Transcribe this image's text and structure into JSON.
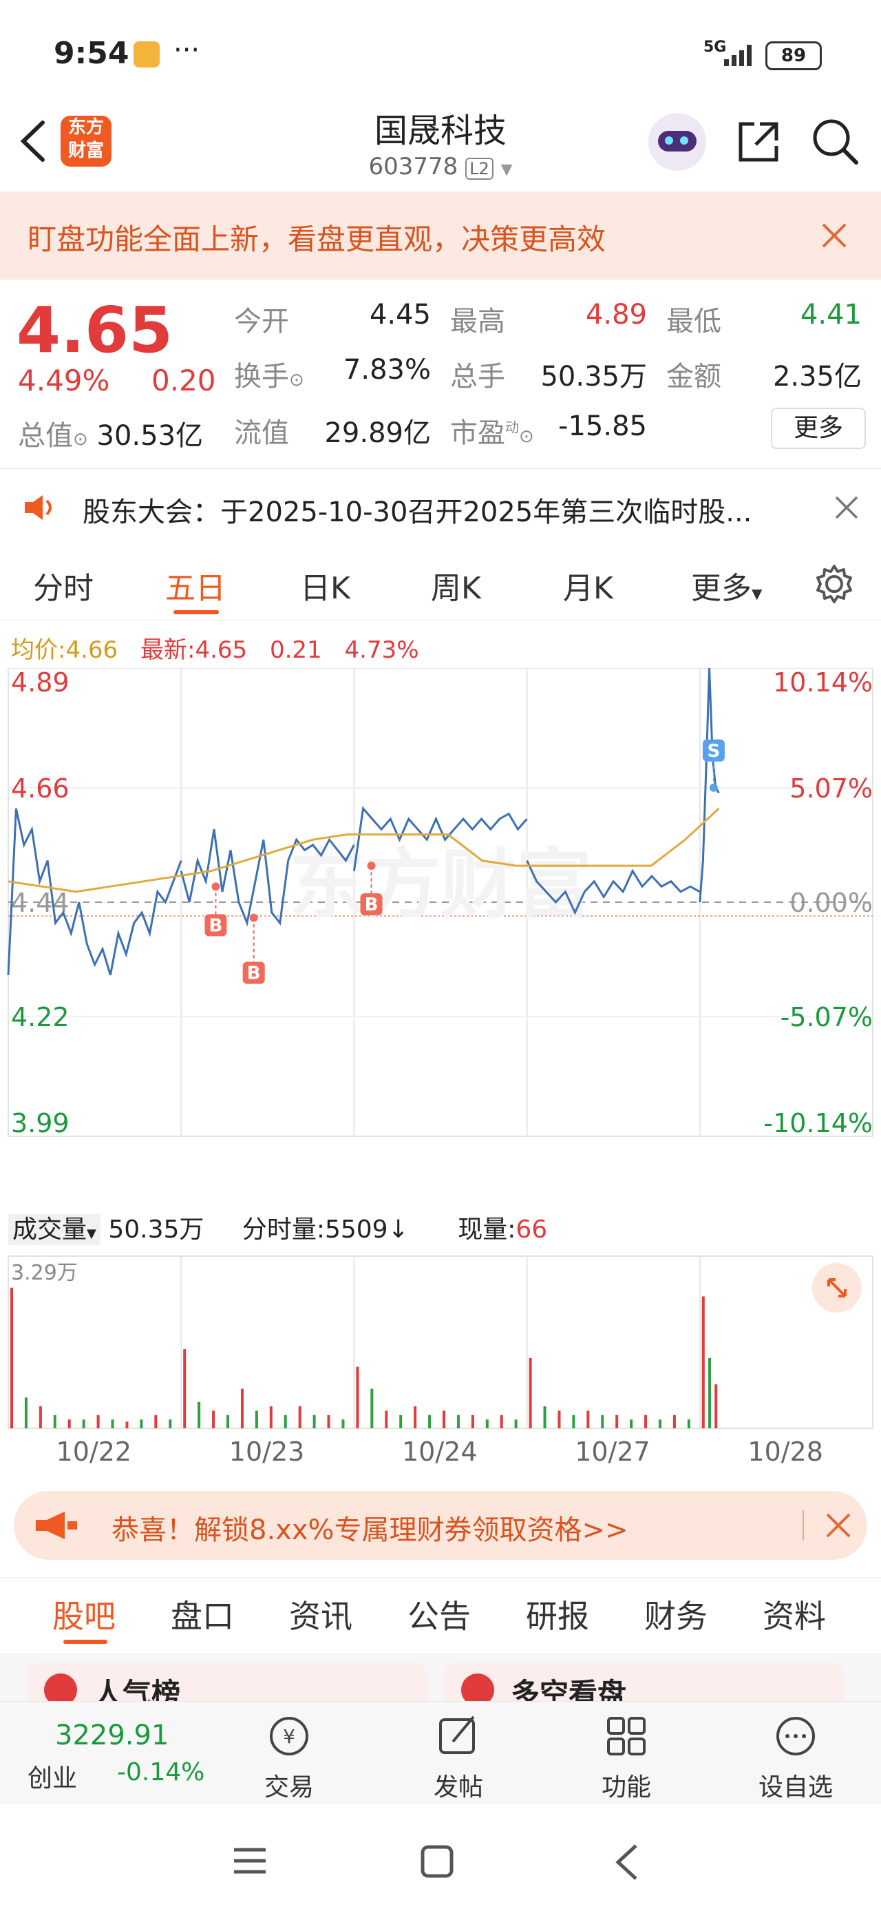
{
  "status_bar": {
    "time": "9:54",
    "more": "···",
    "network": "5G",
    "battery": "89"
  },
  "header": {
    "title": "国晟科技",
    "code": "603778",
    "level": "L2",
    "logo_line1": "东方",
    "logo_line2": "财富"
  },
  "banner": {
    "text": "盯盘功能全面上新，看盘更直观，决策更高效"
  },
  "quote": {
    "price": "4.65",
    "change_pct": "4.49%",
    "change": "0.20",
    "market_cap_label": "总值",
    "market_cap": "30.53亿",
    "fields": [
      {
        "label": "今开",
        "value": "4.45"
      },
      {
        "label": "最高",
        "value": "4.89"
      },
      {
        "label": "最低",
        "value": "4.41"
      },
      {
        "label": "换手",
        "value": "7.83%"
      },
      {
        "label": "总手",
        "value": "50.35万"
      },
      {
        "label": "金额",
        "value": "2.35亿"
      },
      {
        "label": "流值",
        "value": "29.89亿"
      },
      {
        "label": "市盈",
        "value": "-15.85"
      }
    ],
    "pe_tag": "动",
    "more_button": "更多"
  },
  "notice": {
    "text": "股东大会：于2025-10-30召开2025年第三次临时股..."
  },
  "tabs": [
    "分时",
    "五日",
    "日K",
    "周K",
    "月K",
    "更多"
  ],
  "chart_info": {
    "avg_label": "均价:",
    "avg_value": "4.66",
    "latest_label": "最新:",
    "latest_value": "4.65",
    "latest_change": "0.21",
    "latest_pct": "4.73%"
  },
  "chart_data": {
    "type": "line",
    "y_left_ticks": [
      "4.89",
      "4.66",
      "4.44",
      "4.22",
      "3.99"
    ],
    "y_right_ticks": [
      "10.14%",
      "5.07%",
      "0.00%",
      "-5.07%",
      "-10.14%"
    ],
    "ylim": [
      3.99,
      4.89
    ],
    "prev_close": 4.44,
    "x_labels": [
      "10/22",
      "10/23",
      "10/24",
      "10/27",
      "10/28"
    ],
    "days": [
      {
        "day": "10/22",
        "open": 4.3,
        "points": [
          4.3,
          4.62,
          4.55,
          4.58,
          4.48,
          4.52,
          4.4,
          4.42,
          4.38,
          4.44,
          4.36,
          4.32,
          4.35,
          4.3,
          4.38,
          4.34,
          4.4,
          4.42,
          4.38,
          4.46,
          4.44,
          4.48,
          4.52
        ]
      },
      {
        "day": "10/23",
        "open": 4.5,
        "points": [
          4.5,
          4.44,
          4.52,
          4.48,
          4.58,
          4.46,
          4.54,
          4.44,
          4.4,
          4.48,
          4.56,
          4.42,
          4.4,
          4.52,
          4.56,
          4.54,
          4.55,
          4.53,
          4.56,
          4.54,
          4.52,
          4.55
        ]
      },
      {
        "day": "10/24",
        "open": 4.5,
        "points": [
          4.5,
          4.62,
          4.6,
          4.58,
          4.6,
          4.56,
          4.6,
          4.58,
          4.56,
          4.6,
          4.56,
          4.58,
          4.6,
          4.58,
          4.6,
          4.58,
          4.6,
          4.61,
          4.58,
          4.6
        ]
      },
      {
        "day": "10/27",
        "open": 4.52,
        "points": [
          4.52,
          4.48,
          4.46,
          4.44,
          4.46,
          4.42,
          4.46,
          4.48,
          4.45,
          4.48,
          4.46,
          4.5,
          4.47,
          4.49,
          4.47,
          4.48,
          4.46,
          4.47,
          4.46
        ]
      },
      {
        "day": "10/28",
        "open": 4.44,
        "points": [
          4.44,
          4.52,
          4.7,
          4.89,
          4.72,
          4.66,
          4.65
        ]
      }
    ],
    "avg_line": [
      4.48,
      4.47,
      4.46,
      4.47,
      4.48,
      4.49,
      4.5,
      4.52,
      4.54,
      4.56,
      4.57,
      4.57,
      4.57,
      4.57,
      4.52,
      4.51,
      4.51,
      4.51,
      4.51,
      4.51,
      4.56,
      4.62
    ],
    "markers": [
      {
        "type": "B",
        "day": "10/23",
        "at": 0.2,
        "price": 4.47
      },
      {
        "type": "B",
        "day": "10/23",
        "at": 0.42,
        "price": 4.41
      },
      {
        "type": "B",
        "day": "10/24",
        "at": 0.1,
        "price": 4.51
      },
      {
        "type": "S",
        "day": "10/28",
        "at": 0.08,
        "price": 4.66
      }
    ]
  },
  "volume": {
    "label": "成交量",
    "total": "50.35万",
    "tick_label": "分时量:5509",
    "now_label": "现量:",
    "now_value": "66",
    "max_label": "3.29万"
  },
  "volume_data": {
    "max": 3.29,
    "days": [
      [
        3.2,
        0.7,
        0.5,
        0.3,
        0.2,
        0.2,
        0.3,
        0.2,
        0.15,
        0.2,
        0.3,
        0.2
      ],
      [
        1.8,
        0.6,
        0.4,
        0.3,
        0.9,
        0.4,
        0.5,
        0.3,
        0.5,
        0.3,
        0.3,
        0.2
      ],
      [
        1.4,
        0.9,
        0.4,
        0.3,
        0.5,
        0.3,
        0.4,
        0.3,
        0.3,
        0.2,
        0.3,
        0.2
      ],
      [
        1.6,
        0.5,
        0.4,
        0.3,
        0.4,
        0.3,
        0.3,
        0.2,
        0.3,
        0.2,
        0.3,
        0.2
      ],
      [
        3.0,
        1.6,
        1.0
      ]
    ]
  },
  "promo": {
    "text": "恭喜！解锁8.xx%专属理财券领取资格>>"
  },
  "bottom_tabs": [
    "股吧",
    "盘口",
    "资讯",
    "公告",
    "研报",
    "财务",
    "资料"
  ],
  "peek": {
    "left": "人气榜",
    "right": "多空看盘"
  },
  "bottom_nav": {
    "index_value": "3229.91",
    "index_name": "创业",
    "index_change": "-0.14%",
    "items": [
      "交易",
      "发帖",
      "功能",
      "设自选"
    ]
  },
  "colors": {
    "accent": "#ef5a22",
    "up": "#e23b3b",
    "down": "#1a9a3a",
    "line": "#3b6fb6",
    "avg": "#e0a93a"
  }
}
